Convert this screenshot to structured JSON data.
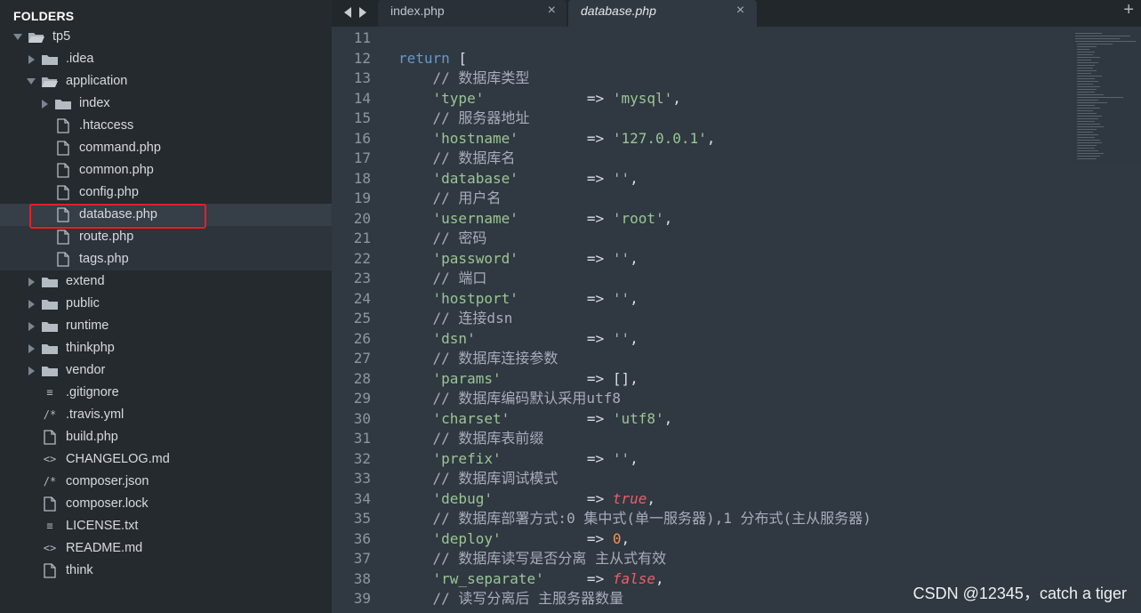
{
  "sidebar": {
    "title": "FOLDERS",
    "tree": [
      {
        "label": "tp5",
        "type": "folder-open",
        "depth": 0,
        "expanded": true
      },
      {
        "label": ".idea",
        "type": "folder",
        "depth": 1,
        "expanded": false
      },
      {
        "label": "application",
        "type": "folder-open",
        "depth": 1,
        "expanded": true
      },
      {
        "label": "index",
        "type": "folder",
        "depth": 2,
        "expanded": false
      },
      {
        "label": ".htaccess",
        "type": "file",
        "depth": 2
      },
      {
        "label": "command.php",
        "type": "file",
        "depth": 2
      },
      {
        "label": "common.php",
        "type": "file",
        "depth": 2
      },
      {
        "label": "config.php",
        "type": "file",
        "depth": 2
      },
      {
        "label": "database.php",
        "type": "file",
        "depth": 2,
        "selected": true
      },
      {
        "label": "route.php",
        "type": "file",
        "depth": 2,
        "shaded": true
      },
      {
        "label": "tags.php",
        "type": "file",
        "depth": 2,
        "shaded": true
      },
      {
        "label": "extend",
        "type": "folder",
        "depth": 1,
        "expanded": false
      },
      {
        "label": "public",
        "type": "folder",
        "depth": 1,
        "expanded": false
      },
      {
        "label": "runtime",
        "type": "folder",
        "depth": 1,
        "expanded": false
      },
      {
        "label": "thinkphp",
        "type": "folder",
        "depth": 1,
        "expanded": false
      },
      {
        "label": "vendor",
        "type": "folder",
        "depth": 1,
        "expanded": false
      },
      {
        "label": ".gitignore",
        "type": "text",
        "icon": "≡",
        "depth": 1
      },
      {
        "label": ".travis.yml",
        "type": "text",
        "icon": "/*",
        "depth": 1
      },
      {
        "label": "build.php",
        "type": "file",
        "depth": 1
      },
      {
        "label": "CHANGELOG.md",
        "type": "text",
        "icon": "<>",
        "depth": 1
      },
      {
        "label": "composer.json",
        "type": "text",
        "icon": "/*",
        "depth": 1
      },
      {
        "label": "composer.lock",
        "type": "file",
        "depth": 1
      },
      {
        "label": "LICENSE.txt",
        "type": "text",
        "icon": "≡",
        "depth": 1
      },
      {
        "label": "README.md",
        "type": "text",
        "icon": "<>",
        "depth": 1
      },
      {
        "label": "think",
        "type": "file",
        "depth": 1
      }
    ]
  },
  "tabs": [
    {
      "label": "index.php",
      "close": "×",
      "active": false
    },
    {
      "label": "database.php",
      "close": "×",
      "active": true
    }
  ],
  "tab_add": "+",
  "editor": {
    "lines": [
      {
        "n": "11",
        "tokens": []
      },
      {
        "n": "12",
        "tokens": [
          {
            "c": "kw",
            "t": "return"
          },
          {
            "c": "pun",
            "t": " ["
          }
        ]
      },
      {
        "n": "13",
        "tokens": [
          {
            "c": "cm",
            "t": "    // 数据库类型"
          }
        ]
      },
      {
        "n": "14",
        "tokens": [
          {
            "c": "pun",
            "t": "    "
          },
          {
            "c": "str",
            "t": "'type'"
          },
          {
            "c": "pun",
            "t": "            => "
          },
          {
            "c": "str",
            "t": "'mysql'"
          },
          {
            "c": "pun",
            "t": ","
          }
        ]
      },
      {
        "n": "15",
        "tokens": [
          {
            "c": "cm",
            "t": "    // 服务器地址"
          }
        ]
      },
      {
        "n": "16",
        "tokens": [
          {
            "c": "pun",
            "t": "    "
          },
          {
            "c": "str",
            "t": "'hostname'"
          },
          {
            "c": "pun",
            "t": "        => "
          },
          {
            "c": "str",
            "t": "'127.0.0.1'"
          },
          {
            "c": "pun",
            "t": ","
          }
        ]
      },
      {
        "n": "17",
        "tokens": [
          {
            "c": "cm",
            "t": "    // 数据库名"
          }
        ]
      },
      {
        "n": "18",
        "tokens": [
          {
            "c": "pun",
            "t": "    "
          },
          {
            "c": "str",
            "t": "'database'"
          },
          {
            "c": "pun",
            "t": "        => "
          },
          {
            "c": "str",
            "t": "''"
          },
          {
            "c": "pun",
            "t": ","
          }
        ]
      },
      {
        "n": "19",
        "tokens": [
          {
            "c": "cm",
            "t": "    // 用户名"
          }
        ]
      },
      {
        "n": "20",
        "tokens": [
          {
            "c": "pun",
            "t": "    "
          },
          {
            "c": "str",
            "t": "'username'"
          },
          {
            "c": "pun",
            "t": "        => "
          },
          {
            "c": "str",
            "t": "'root'"
          },
          {
            "c": "pun",
            "t": ","
          }
        ]
      },
      {
        "n": "21",
        "tokens": [
          {
            "c": "cm",
            "t": "    // 密码"
          }
        ]
      },
      {
        "n": "22",
        "tokens": [
          {
            "c": "pun",
            "t": "    "
          },
          {
            "c": "str",
            "t": "'password'"
          },
          {
            "c": "pun",
            "t": "        => "
          },
          {
            "c": "str",
            "t": "''"
          },
          {
            "c": "pun",
            "t": ","
          }
        ]
      },
      {
        "n": "23",
        "tokens": [
          {
            "c": "cm",
            "t": "    // 端口"
          }
        ]
      },
      {
        "n": "24",
        "tokens": [
          {
            "c": "pun",
            "t": "    "
          },
          {
            "c": "str",
            "t": "'hostport'"
          },
          {
            "c": "pun",
            "t": "        => "
          },
          {
            "c": "str",
            "t": "''"
          },
          {
            "c": "pun",
            "t": ","
          }
        ]
      },
      {
        "n": "25",
        "tokens": [
          {
            "c": "cm",
            "t": "    // 连接dsn"
          }
        ]
      },
      {
        "n": "26",
        "tokens": [
          {
            "c": "pun",
            "t": "    "
          },
          {
            "c": "str",
            "t": "'dsn'"
          },
          {
            "c": "pun",
            "t": "             => "
          },
          {
            "c": "str",
            "t": "''"
          },
          {
            "c": "pun",
            "t": ","
          }
        ]
      },
      {
        "n": "27",
        "tokens": [
          {
            "c": "cm",
            "t": "    // 数据库连接参数"
          }
        ]
      },
      {
        "n": "28",
        "tokens": [
          {
            "c": "pun",
            "t": "    "
          },
          {
            "c": "str",
            "t": "'params'"
          },
          {
            "c": "pun",
            "t": "          => [],"
          }
        ]
      },
      {
        "n": "29",
        "tokens": [
          {
            "c": "cm",
            "t": "    // 数据库编码默认采用utf8"
          }
        ]
      },
      {
        "n": "30",
        "tokens": [
          {
            "c": "pun",
            "t": "    "
          },
          {
            "c": "str",
            "t": "'charset'"
          },
          {
            "c": "pun",
            "t": "         => "
          },
          {
            "c": "str",
            "t": "'utf8'"
          },
          {
            "c": "pun",
            "t": ","
          }
        ]
      },
      {
        "n": "31",
        "tokens": [
          {
            "c": "cm",
            "t": "    // 数据库表前缀"
          }
        ]
      },
      {
        "n": "32",
        "tokens": [
          {
            "c": "pun",
            "t": "    "
          },
          {
            "c": "str",
            "t": "'prefix'"
          },
          {
            "c": "pun",
            "t": "          => "
          },
          {
            "c": "str",
            "t": "''"
          },
          {
            "c": "pun",
            "t": ","
          }
        ]
      },
      {
        "n": "33",
        "tokens": [
          {
            "c": "cm",
            "t": "    // 数据库调试模式"
          }
        ]
      },
      {
        "n": "34",
        "tokens": [
          {
            "c": "pun",
            "t": "    "
          },
          {
            "c": "str",
            "t": "'debug'"
          },
          {
            "c": "pun",
            "t": "           => "
          },
          {
            "c": "bool",
            "t": "true"
          },
          {
            "c": "pun",
            "t": ","
          }
        ]
      },
      {
        "n": "35",
        "tokens": [
          {
            "c": "cm",
            "t": "    // 数据库部署方式:0 集中式(单一服务器),1 分布式(主从服务器)"
          }
        ]
      },
      {
        "n": "36",
        "tokens": [
          {
            "c": "pun",
            "t": "    "
          },
          {
            "c": "str",
            "t": "'deploy'"
          },
          {
            "c": "pun",
            "t": "          => "
          },
          {
            "c": "num",
            "t": "0"
          },
          {
            "c": "pun",
            "t": ","
          }
        ]
      },
      {
        "n": "37",
        "tokens": [
          {
            "c": "cm",
            "t": "    // 数据库读写是否分离 主从式有效"
          }
        ]
      },
      {
        "n": "38",
        "tokens": [
          {
            "c": "pun",
            "t": "    "
          },
          {
            "c": "str",
            "t": "'rw_separate'"
          },
          {
            "c": "pun",
            "t": "     => "
          },
          {
            "c": "bool",
            "t": "false"
          },
          {
            "c": "pun",
            "t": ","
          }
        ]
      },
      {
        "n": "39",
        "tokens": [
          {
            "c": "cm",
            "t": "    // 读写分离后 主服务器数量"
          }
        ]
      }
    ]
  },
  "watermark": "CSDN @12345，catch a tiger"
}
